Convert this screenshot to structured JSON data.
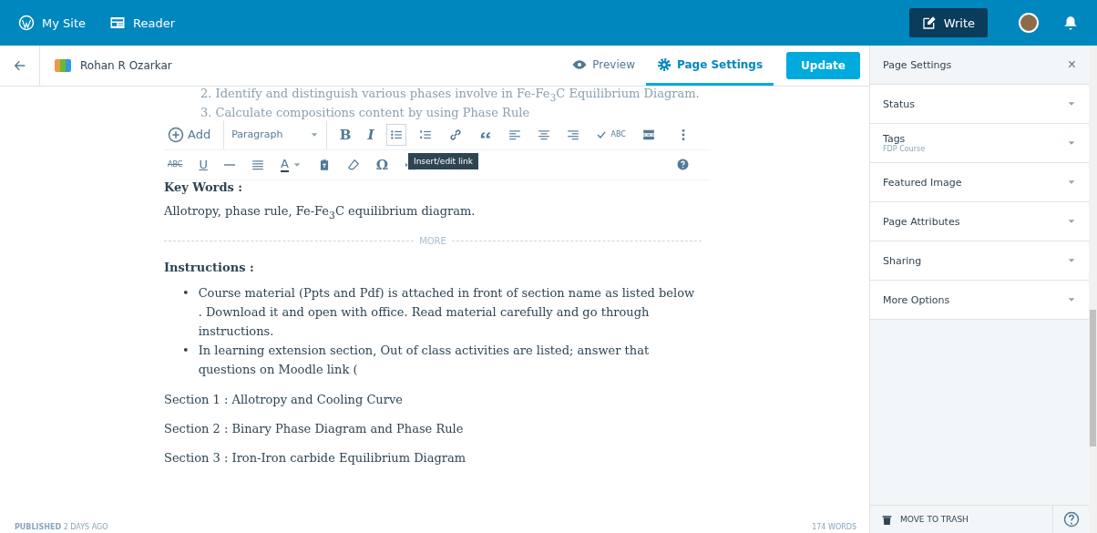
{
  "masterbar": {
    "items": [
      {
        "kind": "wp",
        "label": "My Site"
      },
      {
        "kind": "reader",
        "label": "Reader"
      }
    ],
    "write": "Write"
  },
  "editor_header": {
    "site": "Rohan R Ozarkar",
    "tabs": [
      {
        "kind": "preview",
        "label": "Preview",
        "selected": false
      },
      {
        "kind": "settings",
        "label": "Page Settings",
        "selected": true
      }
    ],
    "update": "Update"
  },
  "toolbar": {
    "row1": [
      {
        "kind": "add",
        "label": "Add",
        "active": false
      },
      {
        "kind": "select",
        "label": "Paragraph",
        "active": false
      },
      {
        "kind": "char",
        "label": "B",
        "active": false
      },
      {
        "kind": "char-italic",
        "label": "I",
        "active": false
      },
      {
        "kind": "bullets",
        "active": true
      },
      {
        "kind": "numbers",
        "active": false
      },
      {
        "kind": "link",
        "active": false
      },
      {
        "kind": "quote",
        "active": false
      },
      {
        "kind": "align-left",
        "active": false
      },
      {
        "kind": "align-center",
        "active": false
      },
      {
        "kind": "align-right",
        "active": false
      },
      {
        "kind": "spell",
        "label": "ABC",
        "active": false
      },
      {
        "kind": "readmore",
        "active": false
      }
    ],
    "row2": [
      {
        "kind": "strike",
        "label": "ABC",
        "active": false
      },
      {
        "kind": "char-underline",
        "label": "U",
        "active": false
      },
      {
        "kind": "hr",
        "active": false
      },
      {
        "kind": "justify",
        "active": false
      },
      {
        "kind": "color",
        "label": "A",
        "active": false
      },
      {
        "kind": "paste",
        "active": false
      },
      {
        "kind": "eraser",
        "active": false
      },
      {
        "kind": "char",
        "label": "Ω",
        "active": false
      },
      {
        "kind": "indent",
        "active": false
      }
    ],
    "tooltip": "Insert/edit link"
  },
  "content": [
    {
      "kind": "faded",
      "text": "2. Identify and distinguish various phases involve in Fe-Fe$_{3}$C Equilibrium Diagram."
    },
    {
      "kind": "faded",
      "text": "3. Calculate compositions content by using Phase Rule"
    },
    {
      "kind": "heading",
      "text": "Key Words :"
    },
    {
      "kind": "para",
      "text": "Allotropy, phase rule, Fe-Fe$_{3}$C equilibrium diagram."
    },
    {
      "kind": "more",
      "text": "MORE"
    },
    {
      "kind": "heading",
      "text": "Instructions :"
    },
    {
      "kind": "list",
      "bullet": "•",
      "items": [
        "Course material (Ppts and Pdf)  is attached in front of section name as listed below . Download it and open with office. Read material carefully and go through instructions.",
        "In learning extension section, Out of class activities are listed; answer that questions on Moodle link ("
      ]
    },
    {
      "kind": "para",
      "text": "Section 1 : Allotropy and Cooling Curve"
    },
    {
      "kind": "para",
      "text": "Section 2 : Binary Phase Diagram and Phase Rule"
    },
    {
      "kind": "para",
      "text": "Section  3 : Iron-Iron carbide Equilibrium Diagram"
    }
  ],
  "status": {
    "published": "PUBLISHED",
    "age": "2 DAYS AGO",
    "words": "174 WORDS"
  },
  "sidebar": {
    "title": "Page Settings",
    "close": "×",
    "sections": [
      {
        "label": "Status"
      },
      {
        "label": "Tags",
        "value": "FDP Course"
      },
      {
        "label": "Featured Image"
      },
      {
        "label": "Page Attributes"
      },
      {
        "label": "Sharing"
      },
      {
        "label": "More Options"
      }
    ],
    "trash": "MOVE TO TRASH"
  }
}
